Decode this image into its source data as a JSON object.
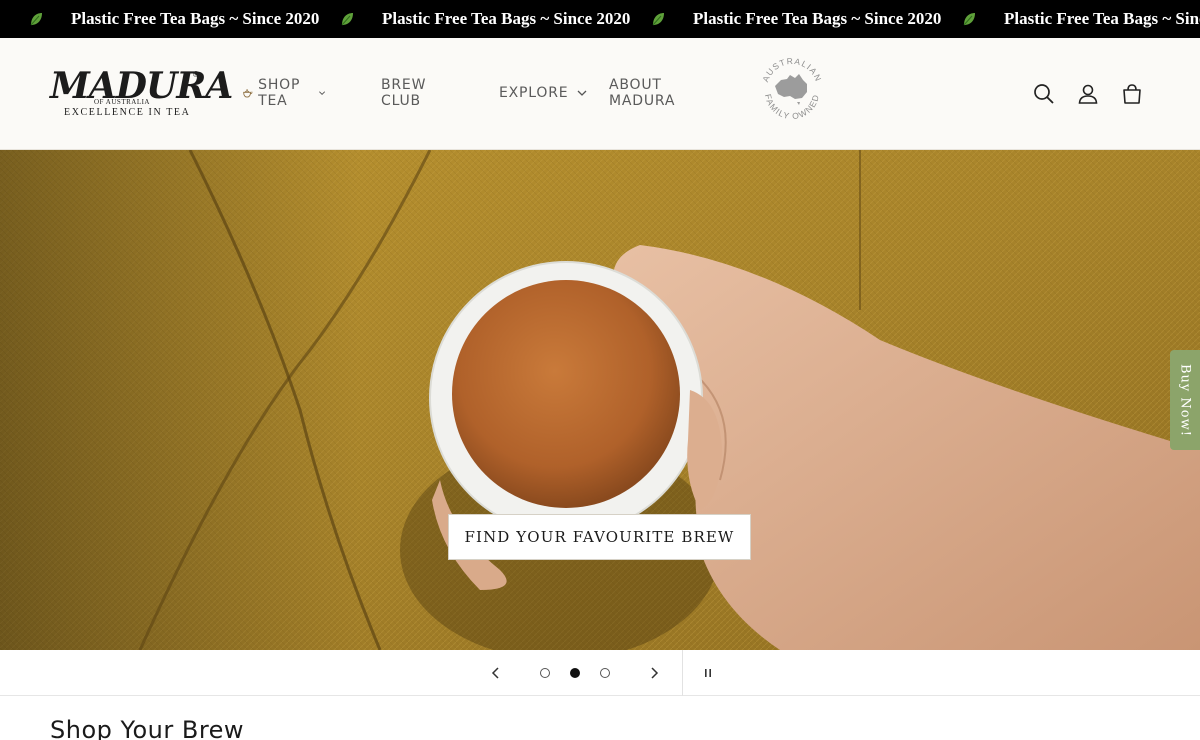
{
  "announcement": {
    "text": "Plastic Free Tea Bags ~ Since 2020",
    "repeat_count": 4,
    "icon": "leaf-icon",
    "background": "#000000"
  },
  "header": {
    "logo": {
      "main": "MADURA",
      "reg": "®",
      "sub": "OF AUSTRALIA",
      "tagline": "EXCELLENCE IN TEA"
    },
    "nav": [
      {
        "label": "SHOP TEA",
        "has_dropdown": true,
        "icon": "teapot-icon"
      },
      {
        "label": "BREW CLUB",
        "has_dropdown": false
      },
      {
        "label": "EXPLORE",
        "has_dropdown": true
      },
      {
        "label": "ABOUT MADURA",
        "has_dropdown": false
      }
    ],
    "badge": {
      "top_text": "AUSTRALIAN",
      "bottom_text": "FAMILY OWNED"
    },
    "icons": [
      "search-icon",
      "account-icon",
      "cart-icon"
    ]
  },
  "hero": {
    "cta_label": "FIND YOUR FAVOURITE BREW",
    "side_tab_label": "Buy Now!",
    "side_tab_color": "#8ca46a"
  },
  "slider": {
    "slide_count": 3,
    "active_slide": 2,
    "prev_icon": "chevron-left-icon",
    "next_icon": "chevron-right-icon",
    "pause_icon": "pause-icon"
  },
  "section": {
    "title": "Shop Your Brew"
  }
}
